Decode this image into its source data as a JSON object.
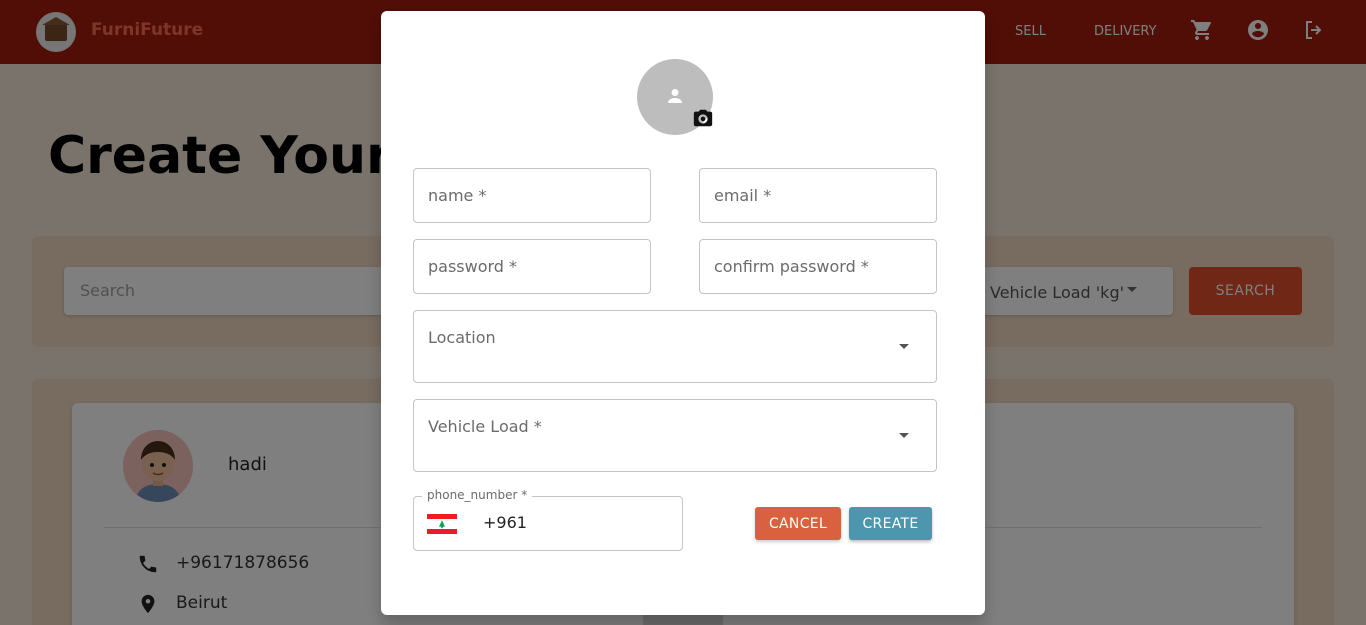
{
  "app": {
    "brand": "FurniFuture",
    "nav": {
      "sell": "SELL",
      "delivery": "DELIVERY"
    },
    "icons": [
      "cart-icon",
      "account-circle-icon",
      "logout-icon"
    ]
  },
  "page": {
    "title": "Create Your Delivery",
    "search_placeholder": "Search",
    "vehicle_load_filter": "Vehicle Load 'kg'",
    "search_button": "SEARCH"
  },
  "card": {
    "name": "hadi",
    "phone": "+96171878656",
    "location": "Beirut"
  },
  "dialog": {
    "name_placeholder": "name *",
    "email_placeholder": "email *",
    "password_placeholder": "password *",
    "confirm_password_placeholder": "confirm password *",
    "location_label": "Location",
    "vehicle_load_label": "Vehicle Load *",
    "phone_label": "phone_number *",
    "phone_value": "+961",
    "phone_country": "Lebanon",
    "cancel_button": "CANCEL",
    "create_button": "CREATE"
  },
  "colors": {
    "navbar": "#a01c0c",
    "cancel": "#d9613f",
    "create": "#4c97ad",
    "search_button": "#e04f2d"
  }
}
